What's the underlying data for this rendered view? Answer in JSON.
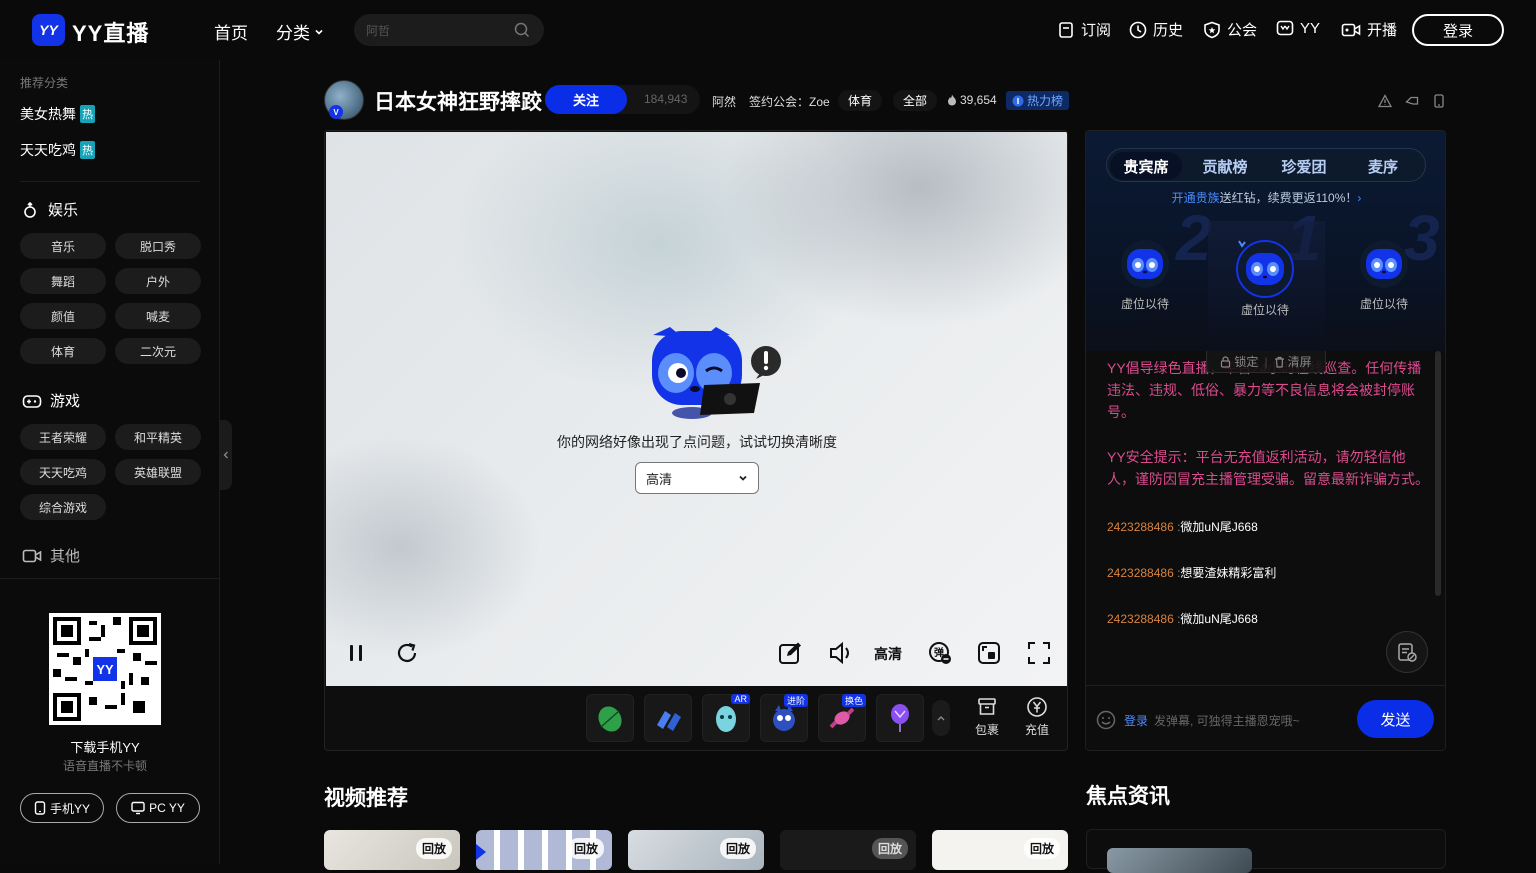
{
  "header": {
    "logo_mark": "YY",
    "logo_text": "YY直播",
    "nav_home": "首页",
    "nav_category": "分类",
    "search_placeholder": "阿哲",
    "subscribe": "订阅",
    "history": "历史",
    "guild": "公会",
    "yy": "YY",
    "broadcast": "开播",
    "login": "登录"
  },
  "sidebar": {
    "recommend_title": "推荐分类",
    "hot_items": [
      {
        "label": "美女热舞",
        "badge": "热"
      },
      {
        "label": "天天吃鸡",
        "badge": "热"
      }
    ],
    "ent_title": "娱乐",
    "ent_items": [
      "音乐",
      "脱口秀",
      "舞蹈",
      "户外",
      "颜值",
      "喊麦",
      "体育",
      "二次元"
    ],
    "game_title": "游戏",
    "game_items": [
      "王者荣耀",
      "和平精英",
      "天天吃鸡",
      "英雄联盟",
      "综合游戏"
    ],
    "other_title": "其他",
    "download_title": "下载手机YY",
    "download_sub": "语音直播不卡顿",
    "mobile_yy": "手机YY",
    "pc_yy": "PC YY"
  },
  "room": {
    "title": "日本女神狂野摔跤",
    "follow": "关注",
    "follow_count": "184,943",
    "anchor_name": "阿然",
    "guild": "签约公会：Zoe",
    "tag_category": "体育",
    "tag_all": "全部",
    "heat": "39,654",
    "rank": "热力榜"
  },
  "player": {
    "error_message": "你的网络好像出现了点问题，试试切换清晰度",
    "quality_value": "高清",
    "quality_label": "高清",
    "gift_badges": [
      "AR",
      "进阶",
      "换色"
    ],
    "bag": "包裹",
    "recharge": "充值"
  },
  "panel": {
    "tabs": [
      "贵宾席",
      "贡献榜",
      "珍爱团",
      "麦序"
    ],
    "promo_link": "开通贵族",
    "promo_text": "送红钻，续费更返110%！",
    "seats": [
      "虚位以待",
      "虚位以待",
      "虚位以待"
    ],
    "rank_numbers": [
      "2",
      "1",
      "3"
    ],
    "lock": "锁定",
    "clear": "清屏",
    "sys_msg_1": "YY倡导绿色直播，平台24小时在线巡查。任何传播违法、违规、低俗、暴力等不良信息将会被封停账号。",
    "sys_msg_2": "YY安全提示：平台无充值返利活动，请勿轻信他人，谨防因冒充主播管理受骗。留意最新诈骗方式。",
    "chats": [
      {
        "user": "2423288486",
        "text": "微加uN尾J668"
      },
      {
        "user": "2423288486",
        "text": "想要渣妹精彩富利"
      },
      {
        "user": "2423288486",
        "text": "微加uN尾J668"
      }
    ],
    "input_login": "登录",
    "input_placeholder": "发弹幕, 可独得主播恩宠哦~",
    "send": "发送"
  },
  "bottom": {
    "video_title": "视频推荐",
    "news_title": "焦点资讯",
    "replay_labels": [
      "回放",
      "回放",
      "回放",
      "回放",
      "回放"
    ]
  },
  "colors": {
    "accent": "#0a2de8",
    "hot_badge": "#16a3b8",
    "system_msg": "#d94c8e",
    "chat_user": "#d9843e"
  }
}
